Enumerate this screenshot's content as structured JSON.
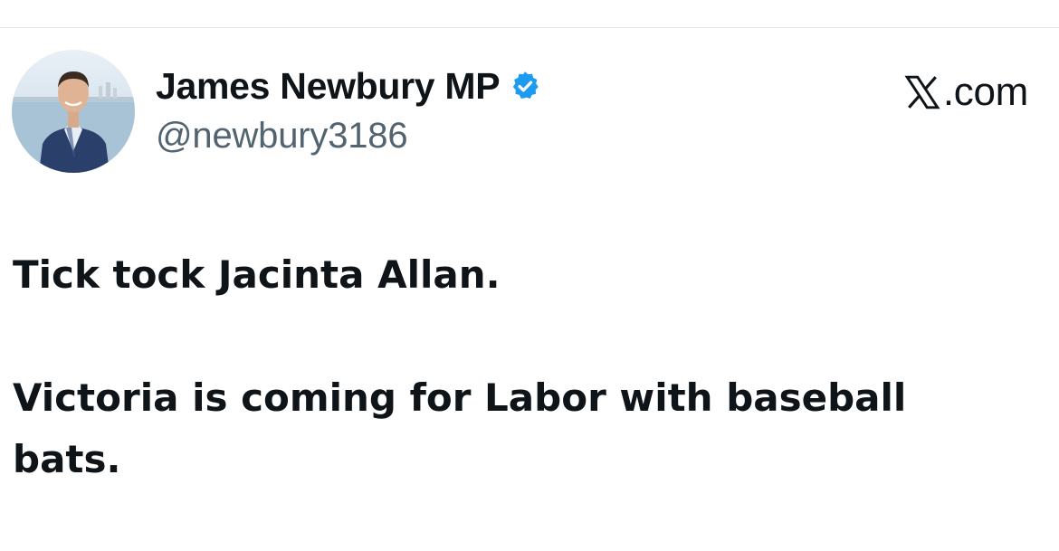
{
  "post": {
    "author": {
      "display_name": "James Newbury MP",
      "handle": "@newbury3186",
      "verified_icon": "verified-badge-icon",
      "badge_color": "#1d9bf0"
    },
    "site": {
      "domain": ".com",
      "logo_icon": "x-logo-icon"
    },
    "text": {
      "line1": "Tick tock Jacinta Allan.",
      "line2": "Victoria is coming for Labor with baseball",
      "line3": "bats."
    }
  }
}
